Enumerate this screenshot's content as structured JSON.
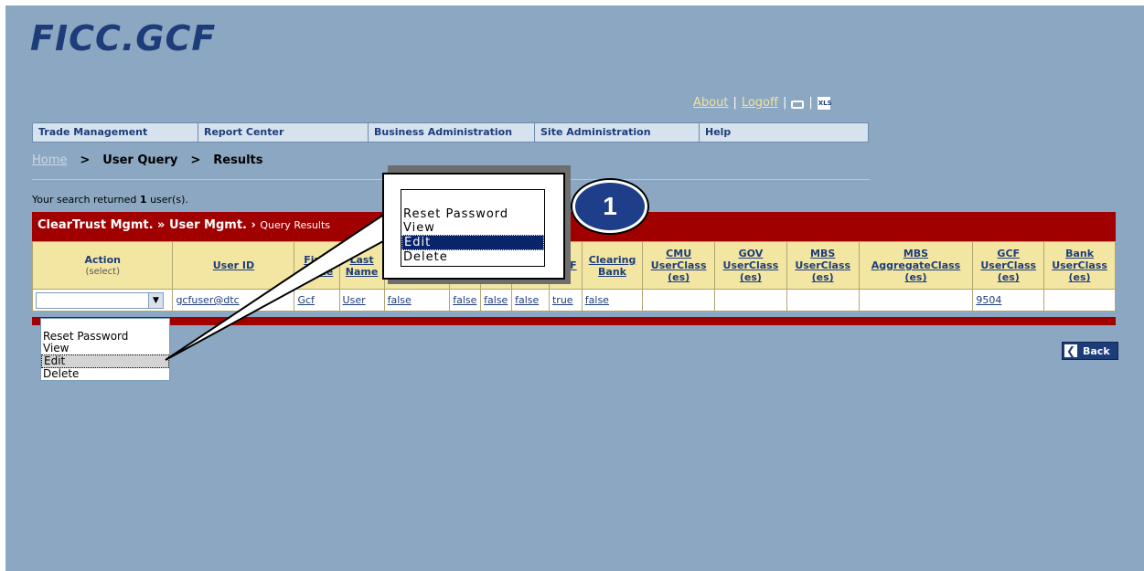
{
  "brand": {
    "logo_text": "FICC.GCF"
  },
  "top_links": {
    "about": "About",
    "logoff": "Logoff",
    "sep": "|"
  },
  "menu": [
    "Trade Management",
    "Report Center",
    "Business Administration",
    "Site Administration",
    "Help"
  ],
  "breadcrumb": {
    "home": "Home",
    "sep": ">",
    "level1": "User Query",
    "level2": "Results"
  },
  "summary": {
    "prefix": "Your search returned",
    "count": "1",
    "suffix": "user(s)."
  },
  "panel": {
    "part1": "ClearTrust Mgmt. »",
    "part2": "User Mgmt. ›",
    "part3": "Query Results"
  },
  "table": {
    "headers": {
      "action": "Action",
      "action_sub": "(select)",
      "user_id": "User ID",
      "first_name": "First Name",
      "last_name": "Last Name",
      "gcf": "GCF",
      "clearing_bank": "Clearing Bank",
      "cmu": "CMU UserClass (es)",
      "gov": "GOV UserClass (es)",
      "mbs": "MBS UserClass (es)",
      "mbs_agg": "MBS AggregateClass (es)",
      "gcf_uc": "GCF UserClass (es)",
      "bank_uc": "Bank UserClass (es)"
    },
    "row": {
      "user_id": "gcfuser@dtc",
      "first_name": "Gcf",
      "last_name": "User",
      "f1": "false",
      "f2": "false",
      "f3": "false",
      "f4": "false",
      "gcf": "true",
      "clearing_bank": "false",
      "cmu": "",
      "gov": "",
      "mbs": "",
      "mbs_agg": "",
      "gcf_uc": "9504",
      "bank_uc": ""
    }
  },
  "action_select": {
    "value": "",
    "options": [
      "Reset Password",
      "View",
      "Edit",
      "Delete"
    ],
    "highlighted": "Edit"
  },
  "callout": {
    "options": [
      "Reset Password",
      "View",
      "Edit",
      "Delete"
    ],
    "step": "1"
  },
  "back_button": {
    "label": "Back"
  }
}
